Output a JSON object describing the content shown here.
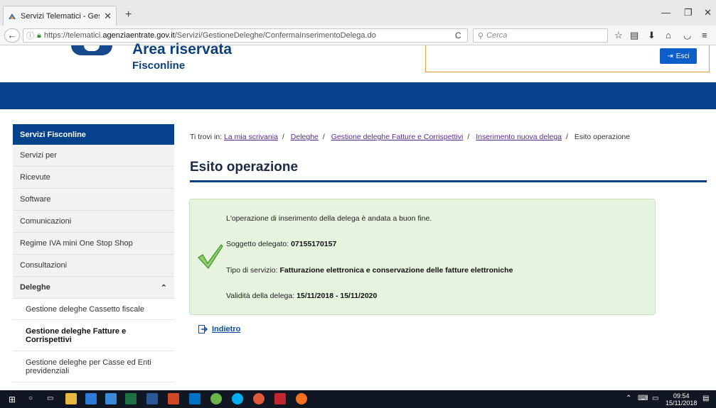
{
  "browser": {
    "tab_title": "Servizi Telematici - Gestione",
    "url_prefix": "https://telematici.",
    "url_domain": "agenziaentrate.gov.it",
    "url_path": "/Servizi/GestioneDeleghe/ConfermaInserimentoDelega.do",
    "search_placeholder": "Cerca"
  },
  "header": {
    "area_title": "Area riservata",
    "subtitle": "Fisconline",
    "exit_label": "Esci"
  },
  "sidebar": {
    "title": "Servizi Fisconline",
    "items": [
      "Servizi per",
      "Ricevute",
      "Software",
      "Comunicazioni",
      "Regime IVA mini One Stop Shop",
      "Consultazioni"
    ],
    "section": "Deleghe",
    "subitems": [
      "Gestione deleghe Cassetto fiscale",
      "Gestione deleghe Fatture e Corrispettivi",
      "Gestione deleghe per Casse ed Enti previdenziali"
    ]
  },
  "breadcrumb": {
    "prefix": "Ti trovi in:",
    "links": [
      "La mia scrivania",
      "Deleghe",
      "Gestione deleghe Fatture e Corrispettivi",
      "Inserimento nuova delega"
    ],
    "current": "Esito operazione"
  },
  "main": {
    "title": "Esito operazione",
    "message": "L'operazione di inserimento della delega è andata a buon fine.",
    "delegate_label": "Soggetto delegato:",
    "delegate_value": "07155170157",
    "service_label": "Tipo di servizio:",
    "service_value": "Fatturazione elettronica e conservazione delle fatture elettroniche",
    "validity_label": "Validità della delega:",
    "validity_value": "15/11/2018 - 15/11/2020",
    "back_label": "Indietro"
  },
  "taskbar": {
    "time": "09:54",
    "date": "15/11/2018"
  },
  "colors": {
    "brand_blue": "#06418b",
    "success_bg": "#e6f3df",
    "link_purple": "#5a2a91",
    "accent_orange": "#e59a3b"
  }
}
